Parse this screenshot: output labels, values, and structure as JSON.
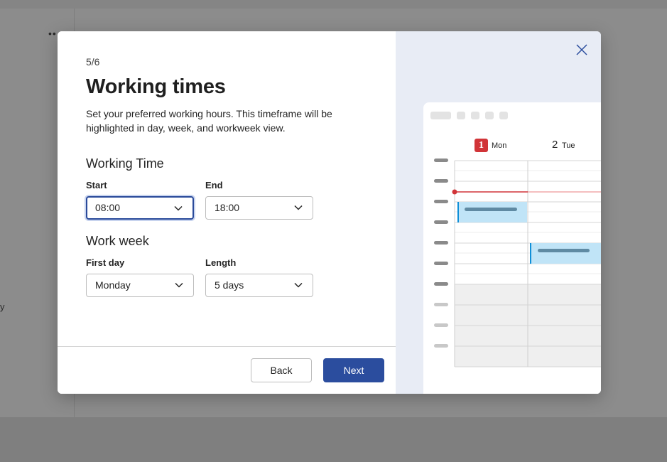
{
  "background": {
    "dots": "••",
    "side_text": "y"
  },
  "dialog": {
    "step": "5/6",
    "title": "Working times",
    "description": "Set your preferred working hours. This timeframe will be highlighted in day, week, and workweek view.",
    "working_time": {
      "heading": "Working Time",
      "start_label": "Start",
      "start_value": "08:00",
      "end_label": "End",
      "end_value": "18:00"
    },
    "work_week": {
      "heading": "Work week",
      "first_day_label": "First day",
      "first_day_value": "Monday",
      "length_label": "Length",
      "length_value": "5 days"
    },
    "buttons": {
      "back": "Back",
      "next": "Next"
    },
    "preview": {
      "day1_num": "1",
      "day1_label": "Mon",
      "day2_num": "2",
      "day2_label": "Tue"
    }
  },
  "colors": {
    "accent": "#2b4d9e",
    "today": "#d13438",
    "event": "#c0e4f7",
    "event_bar": "#0f8fd8"
  },
  "icons": {
    "close": "close-icon",
    "chevron": "chevron-down-icon"
  }
}
